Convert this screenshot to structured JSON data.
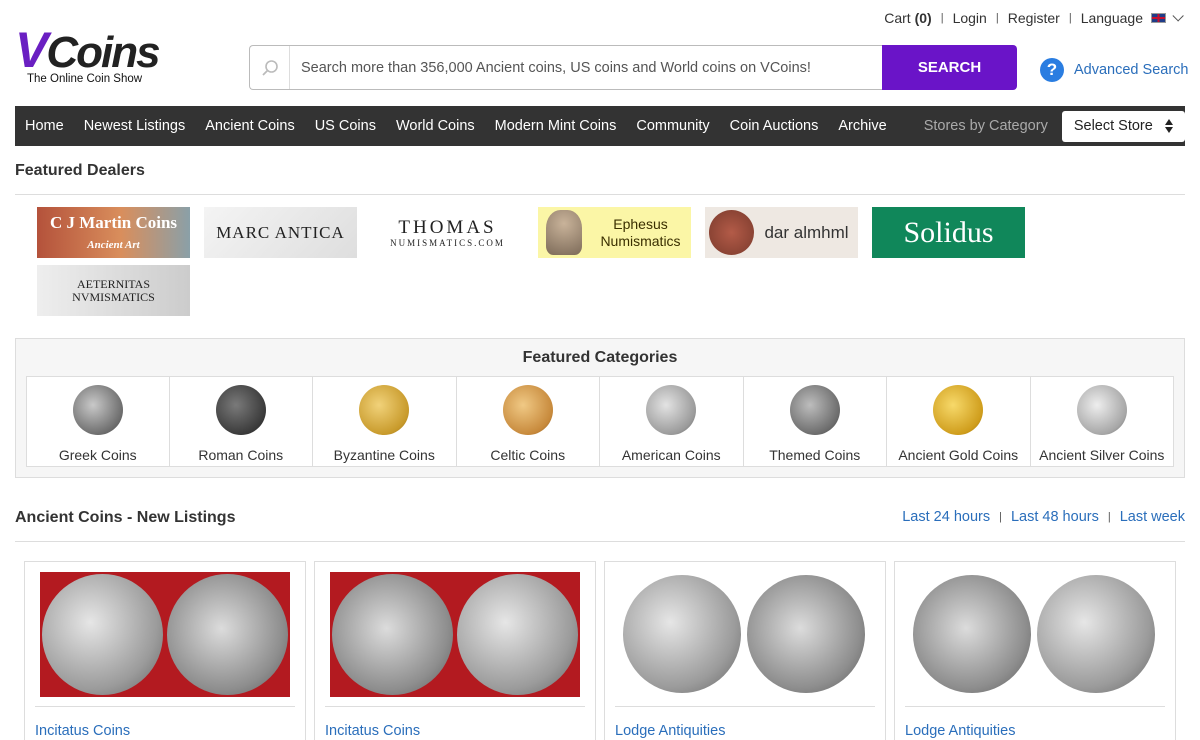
{
  "util": {
    "cart_label": "Cart",
    "cart_count": "(0)",
    "login": "Login",
    "register": "Register",
    "language": "Language"
  },
  "logo": {
    "v": "V",
    "rest": "Coins",
    "tagline": "The Online Coin Show"
  },
  "search": {
    "placeholder": "Search more than 356,000 Ancient coins, US coins and World coins on VCoins!",
    "button": "SEARCH",
    "advanced": "Advanced Search"
  },
  "nav": {
    "items": [
      "Home",
      "Newest Listings",
      "Ancient Coins",
      "US Coins",
      "World Coins",
      "Modern Mint Coins",
      "Community",
      "Coin Auctions",
      "Archive"
    ],
    "stores_label": "Stores by Category",
    "select_store": "Select Store"
  },
  "featured_dealers": {
    "title": "Featured Dealers",
    "dealers": [
      {
        "name": "C J Martin Coins",
        "sub": "Ancient Art"
      },
      {
        "name": "MARC ANTICA"
      },
      {
        "name": "THOMAS",
        "sub": "NUMISMATICS.COM"
      },
      {
        "name": "Ephesus",
        "sub": "Numismatics"
      },
      {
        "name": "dar almhml"
      },
      {
        "name": "Solidus"
      },
      {
        "name": "AETERNITAS",
        "sub": "NVMISMATICS"
      }
    ]
  },
  "featured_categories": {
    "title": "Featured Categories",
    "items": [
      "Greek Coins",
      "Roman Coins",
      "Byzantine Coins",
      "Celtic Coins",
      "American Coins",
      "Themed Coins",
      "Ancient Gold Coins",
      "Ancient Silver Coins"
    ]
  },
  "listings": {
    "title": "Ancient Coins - New Listings",
    "time_filters": [
      "Last 24 hours",
      "Last 48 hours",
      "Last week"
    ],
    "cards": [
      {
        "dealer": "Incitatus Coins"
      },
      {
        "dealer": "Incitatus Coins"
      },
      {
        "dealer": "Lodge Antiquities"
      },
      {
        "dealer": "Lodge Antiquities"
      }
    ]
  },
  "colors": {
    "brand_purple": "#6a14c8",
    "nav_bg": "#333333",
    "link_blue": "#2a6ebb"
  }
}
